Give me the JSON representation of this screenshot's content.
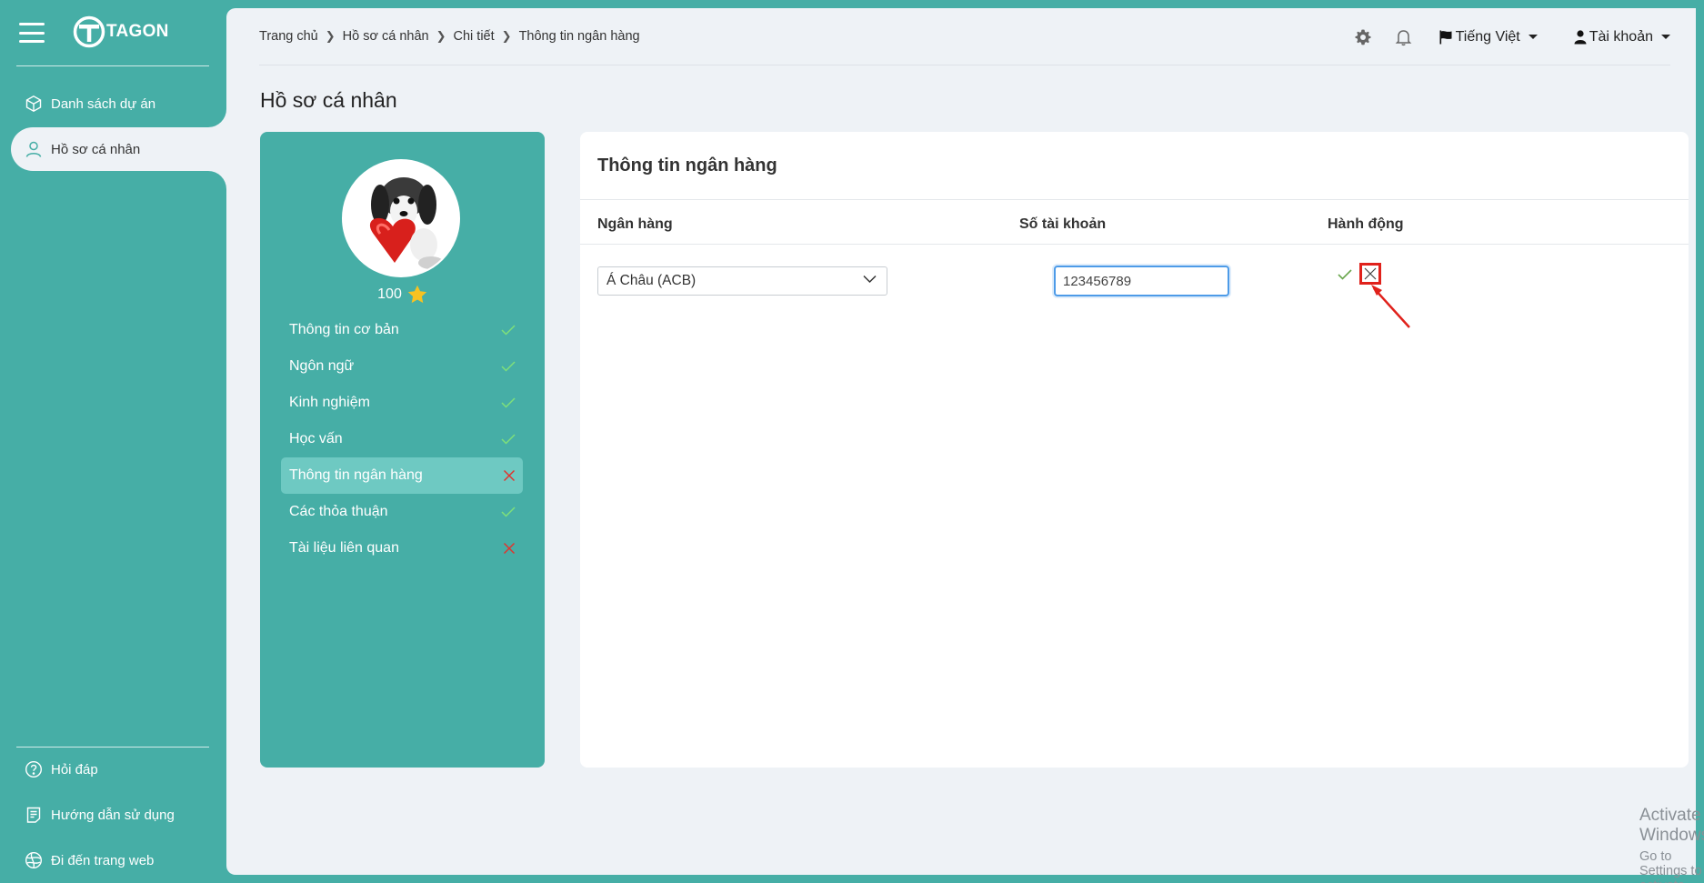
{
  "brand": {
    "logo_text": "TAGON"
  },
  "sidebar": {
    "items": [
      {
        "label": "Danh sách dự án",
        "icon": "cube-icon"
      },
      {
        "label": "Hồ sơ cá nhân",
        "icon": "user-icon",
        "active": true
      }
    ],
    "bottom_items": [
      {
        "label": "Hỏi đáp",
        "icon": "question-circle-icon"
      },
      {
        "label": "Hướng dẫn sử dụng",
        "icon": "document-icon"
      },
      {
        "label": "Đi đến trang web",
        "icon": "globe-icon"
      }
    ]
  },
  "header": {
    "breadcrumb": [
      "Trang chủ",
      "Hồ sơ cá nhân",
      "Chi tiết",
      "Thông tin ngân hàng"
    ],
    "language": "Tiếng Việt",
    "account": "Tài khoản"
  },
  "page": {
    "title": "Hồ sơ cá nhân"
  },
  "profile": {
    "score": "100",
    "steps": [
      {
        "label": "Thông tin cơ bản",
        "status": "done"
      },
      {
        "label": "Ngôn ngữ",
        "status": "done"
      },
      {
        "label": "Kinh nghiệm",
        "status": "done"
      },
      {
        "label": "Học vấn",
        "status": "done"
      },
      {
        "label": "Thông tin ngân hàng",
        "status": "missing",
        "active": true
      },
      {
        "label": "Các thỏa thuận",
        "status": "done"
      },
      {
        "label": "Tài liệu liên quan",
        "status": "missing"
      }
    ]
  },
  "bank": {
    "title": "Thông tin ngân hàng",
    "columns": {
      "bank": "Ngân hàng",
      "account": "Số tài khoản",
      "action": "Hành động"
    },
    "row": {
      "bank": "Á Châu (ACB)",
      "account_number": "123456789"
    }
  },
  "colors": {
    "brand": "#46aea6",
    "check": "#7fe07a",
    "cross": "#e0342e",
    "annotation": "#e0211b"
  },
  "watermark": {
    "line1": "Activate Windows",
    "line2": "Go to Settings to activate Windows."
  }
}
